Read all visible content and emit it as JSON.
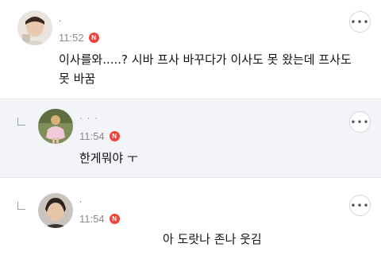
{
  "comments": [
    {
      "username": ".",
      "time": "11:52",
      "badge": "N",
      "text": "이사를와.....? 시바 프사 바꾸다가 이사도 못 왔는데 프사도 못 바꿈",
      "more_label": "•••"
    },
    {
      "username": "·  ·  ·",
      "time": "11:54",
      "badge": "N",
      "text": "한게뭐야 ㅜ",
      "more_label": "•••"
    },
    {
      "username": "·",
      "time": "11:54",
      "badge": "N",
      "text": "아 도랏나 존나 웃김",
      "more_label": "•••"
    }
  ],
  "icons": {
    "reply": "reply-arrow-icon",
    "more": "more-options-icon",
    "new_badge": "new-badge-icon"
  },
  "colors": {
    "badge": "#f0433a",
    "reply_background": "#f2f4f8",
    "time_text": "#8a8a8a"
  }
}
